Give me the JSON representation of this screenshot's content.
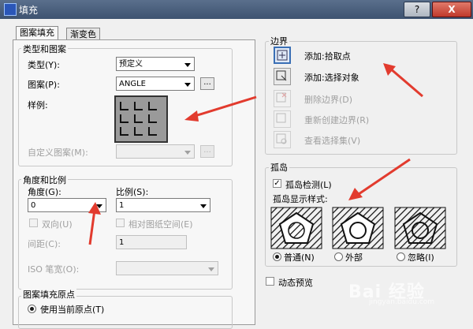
{
  "window": {
    "title": "填充",
    "help_label": "?",
    "close_label": "X"
  },
  "tabs": [
    {
      "label": "图案填充",
      "active": true
    },
    {
      "label": "渐变色",
      "active": false
    }
  ],
  "type_pattern": {
    "group_title": "类型和图案",
    "type_label": "类型(Y):",
    "type_value": "预定义",
    "pattern_label": "图案(P):",
    "pattern_value": "ANGLE",
    "browse_label": "...",
    "sample_label": "样例:",
    "custom_label": "自定义图案(M):",
    "custom_value": ""
  },
  "angle_scale": {
    "group_title": "角度和比例",
    "angle_label": "角度(G):",
    "angle_value": "0",
    "scale_label": "比例(S):",
    "scale_value": "1",
    "double_label": "双向(U)",
    "relative_label": "相对图纸空间(E)",
    "spacing_label": "间距(C):",
    "spacing_value": "1",
    "iso_label": "ISO 笔宽(O):",
    "iso_value": ""
  },
  "origin": {
    "group_title": "图案填充原点",
    "use_current_label": "使用当前原点(T)"
  },
  "boundaries": {
    "group_title": "边界",
    "items": [
      {
        "label": "添加:拾取点",
        "enabled": true
      },
      {
        "label": "添加:选择对象",
        "enabled": true
      },
      {
        "label": "删除边界(D)",
        "enabled": false
      },
      {
        "label": "重新创建边界(R)",
        "enabled": false
      },
      {
        "label": "查看选择集(V)",
        "enabled": false
      }
    ]
  },
  "islands": {
    "group_title": "孤岛",
    "detect_label": "孤岛检测(L)",
    "detect_checked": true,
    "style_label": "孤岛显示样式:",
    "styles": [
      {
        "label": "普通(N)",
        "selected": true
      },
      {
        "label": "外部",
        "selected": false
      },
      {
        "label": "忽略(I)",
        "selected": false
      }
    ]
  },
  "dynamic_preview_label": "动态预览",
  "watermark": {
    "main": "Bai 经验",
    "sub": "jingyan.baidu.com"
  },
  "colors": {
    "annotation_red": "#e23b2e",
    "selection_blue": "#3a6fb5"
  }
}
